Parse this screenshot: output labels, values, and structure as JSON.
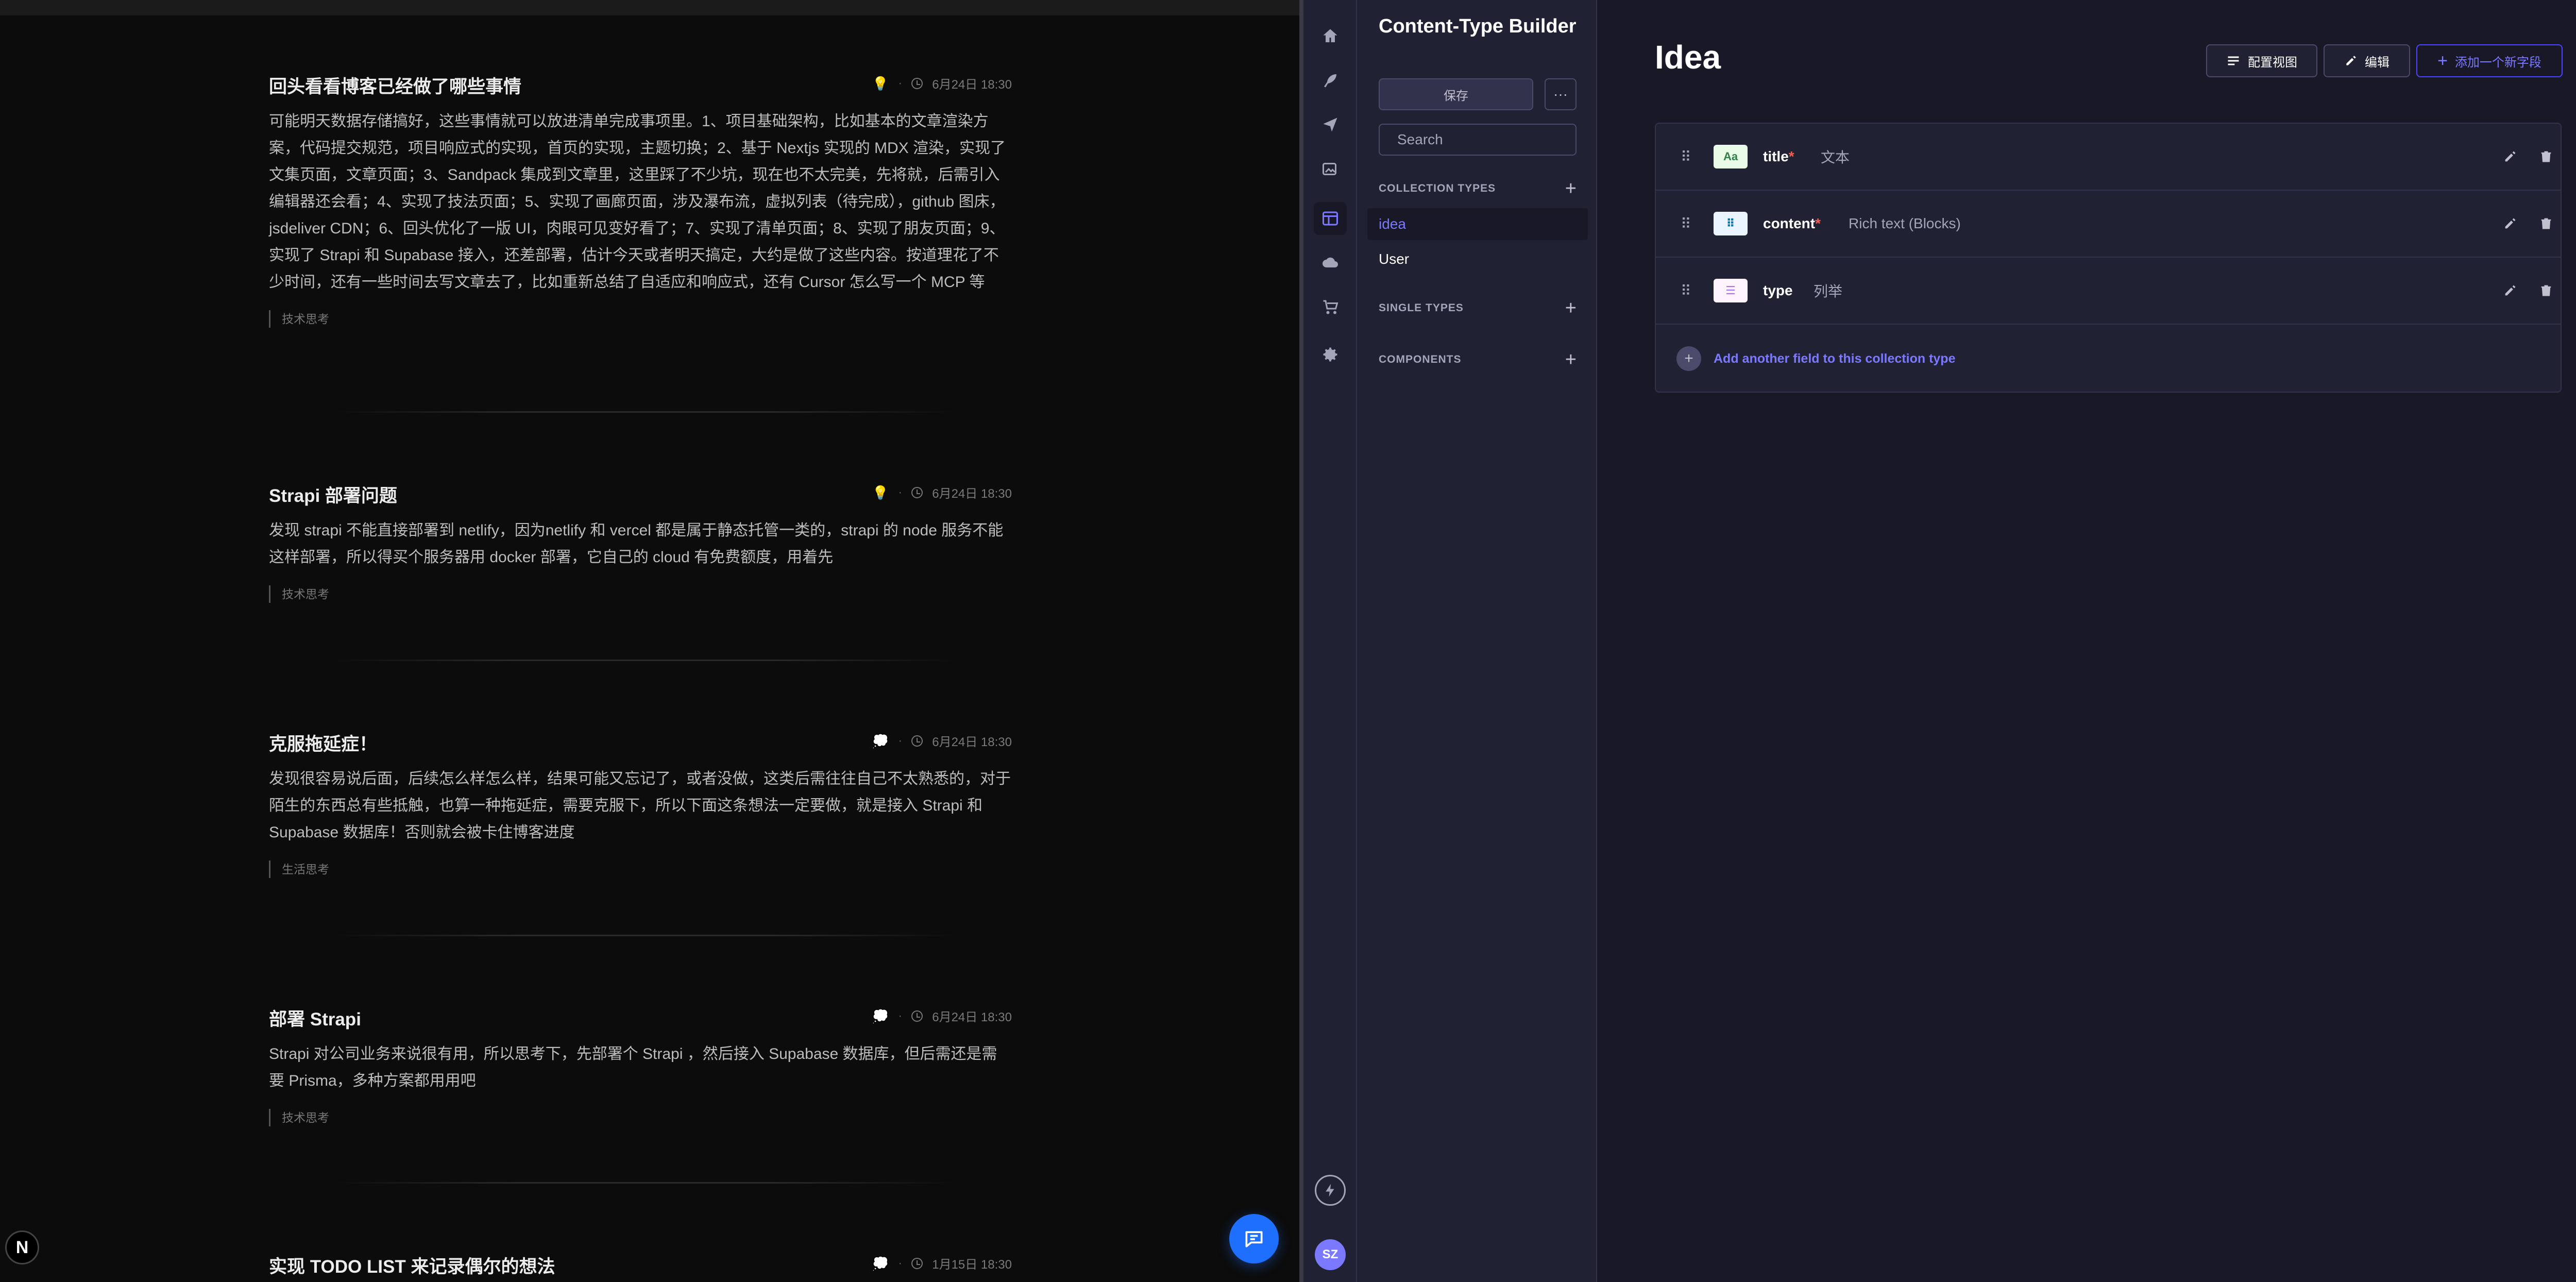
{
  "blog": {
    "posts": [
      {
        "title": "回头看看博客已经做了哪些事情",
        "icon": "lightbulb-icon",
        "date": "6月24日 18:30",
        "body": "可能明天数据存储搞好，这些事情就可以放进清单完成事项里。1、项目基础架构，比如基本的文章渲染方案，代码提交规范，项目响应式的实现，首页的实现，主题切换；2、基于 Nextjs 实现的 MDX 渲染，实现了文集页面，文章页面；3、Sandpack 集成到文章里，这里踩了不少坑，现在也不太完美，先将就，后需引入编辑器还会看；4、实现了技法页面；5、实现了画廊页面，涉及瀑布流，虚拟列表（待完成），github 图床，jsdeliver CDN；6、回头优化了一版 UI，肉眼可见变好看了；7、实现了清单页面；8、实现了朋友页面；9、实现了 Strapi 和 Supabase 接入，还差部署，估计今天或者明天搞定，大约是做了这些内容。按道理花了不少时间，还有一些时间去写文章去了，比如重新总结了自适应和响应式，还有 Cursor 怎么写一个 MCP 等",
        "tag": "技术思考"
      },
      {
        "title": "Strapi 部署问题",
        "icon": "lightbulb-icon",
        "date": "6月24日 18:30",
        "body": "发现 strapi 不能直接部署到 netlify，因为netlify 和 vercel 都是属于静态托管一类的，strapi 的 node 服务不能这样部署，所以得买个服务器用 docker 部署，它自己的 cloud 有免费额度，用着先",
        "tag": "技术思考"
      },
      {
        "title": "克服拖延症！",
        "icon": "thought-bubble-icon",
        "date": "6月24日 18:30",
        "body": "发现很容易说后面，后续怎么样怎么样，结果可能又忘记了，或者没做，这类后需往往自己不太熟悉的，对于陌生的东西总有些抵触，也算一种拖延症，需要克服下，所以下面这条想法一定要做，就是接入 Strapi 和 Supabase 数据库！否则就会被卡住博客进度",
        "tag": "生活思考"
      },
      {
        "title": "部署 Strapi",
        "icon": "thought-bubble-icon",
        "date": "6月24日 18:30",
        "body": "Strapi 对公司业务来说很有用，所以思考下，先部署个 Strapi ，然后接入 Supabase 数据库，但后需还是需要 Prisma，多种方案都用用吧",
        "tag": "技术思考"
      },
      {
        "title": "实现 TODO LIST 来记录偶尔的想法",
        "icon": "thought-bubble-icon",
        "date": "1月15日 18:30",
        "body": "",
        "tag": ""
      }
    ],
    "next_badge": "N"
  },
  "strapi": {
    "sub_nav": {
      "title": "Content-Type Builder",
      "save_label": "保存",
      "more_label": "···",
      "search_placeholder": "Search",
      "collection_types_label": "COLLECTION TYPES",
      "collection_types": [
        "idea",
        "User"
      ],
      "single_types_label": "SINGLE TYPES",
      "components_label": "COMPONENTS"
    },
    "avatar_initials": "SZ",
    "content": {
      "title": "Idea",
      "configure_view_label": "配置视图",
      "edit_label": "编辑",
      "add_field_label": "添加一个新字段",
      "fields": [
        {
          "name": "title",
          "required": true,
          "type": "文本",
          "icon_text": "Aa",
          "icon_bg": "#eafbe7",
          "icon_color": "#328048"
        },
        {
          "name": "content",
          "required": true,
          "type": "Rich text (Blocks)",
          "icon_text": "⠿",
          "icon_bg": "#eaf5ff",
          "icon_color": "#0c75af"
        },
        {
          "name": "type",
          "required": false,
          "type": "列举",
          "icon_text": "☰",
          "icon_bg": "#fdf4ff",
          "icon_color": "#ac73e6"
        }
      ],
      "add_another_label": "Add another field to this collection type"
    }
  }
}
